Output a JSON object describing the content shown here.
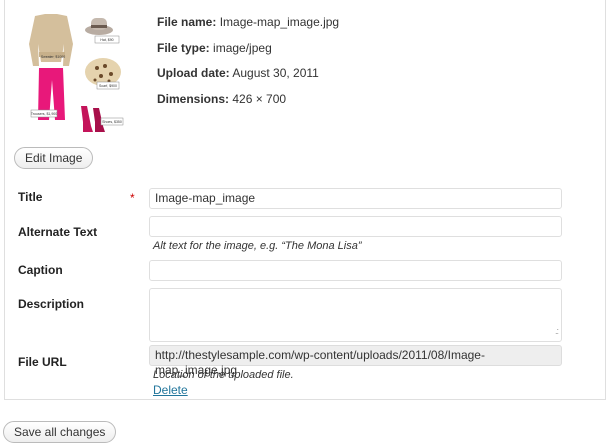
{
  "media": {
    "thumbnail_icon": "image-thumbnail",
    "thumbnail_captions": [
      "Sweater, $1000",
      "Hat, $90",
      "Scarf, $900",
      "Trousers, $1,900",
      "Shoes, $350"
    ],
    "file_name_label": "File name:",
    "file_name": "Image-map_image.jpg",
    "file_type_label": "File type:",
    "file_type": "image/jpeg",
    "upload_date_label": "Upload date:",
    "upload_date": "August 30, 2011",
    "dimensions_label": "Dimensions:",
    "dimensions": "426 × 700"
  },
  "buttons": {
    "edit_image": "Edit Image",
    "save_all": "Save all changes"
  },
  "form": {
    "title_label": "Title",
    "required_mark": "*",
    "title_value": "Image-map_image",
    "alt_label": "Alternate Text",
    "alt_value": "",
    "alt_help": "Alt text for the image, e.g. “The Mona Lisa”",
    "caption_label": "Caption",
    "caption_value": "",
    "description_label": "Description",
    "description_value": "",
    "file_url_label": "File URL",
    "file_url_value": "http://thestylesample.com/wp-content/uploads/2011/08/Image-map_image.jpg",
    "file_url_help": "Location of the uploaded file.",
    "delete_link": "Delete"
  },
  "colors": {
    "link": "#21759b",
    "required": "#cc0000",
    "border": "#dfdfdf"
  }
}
